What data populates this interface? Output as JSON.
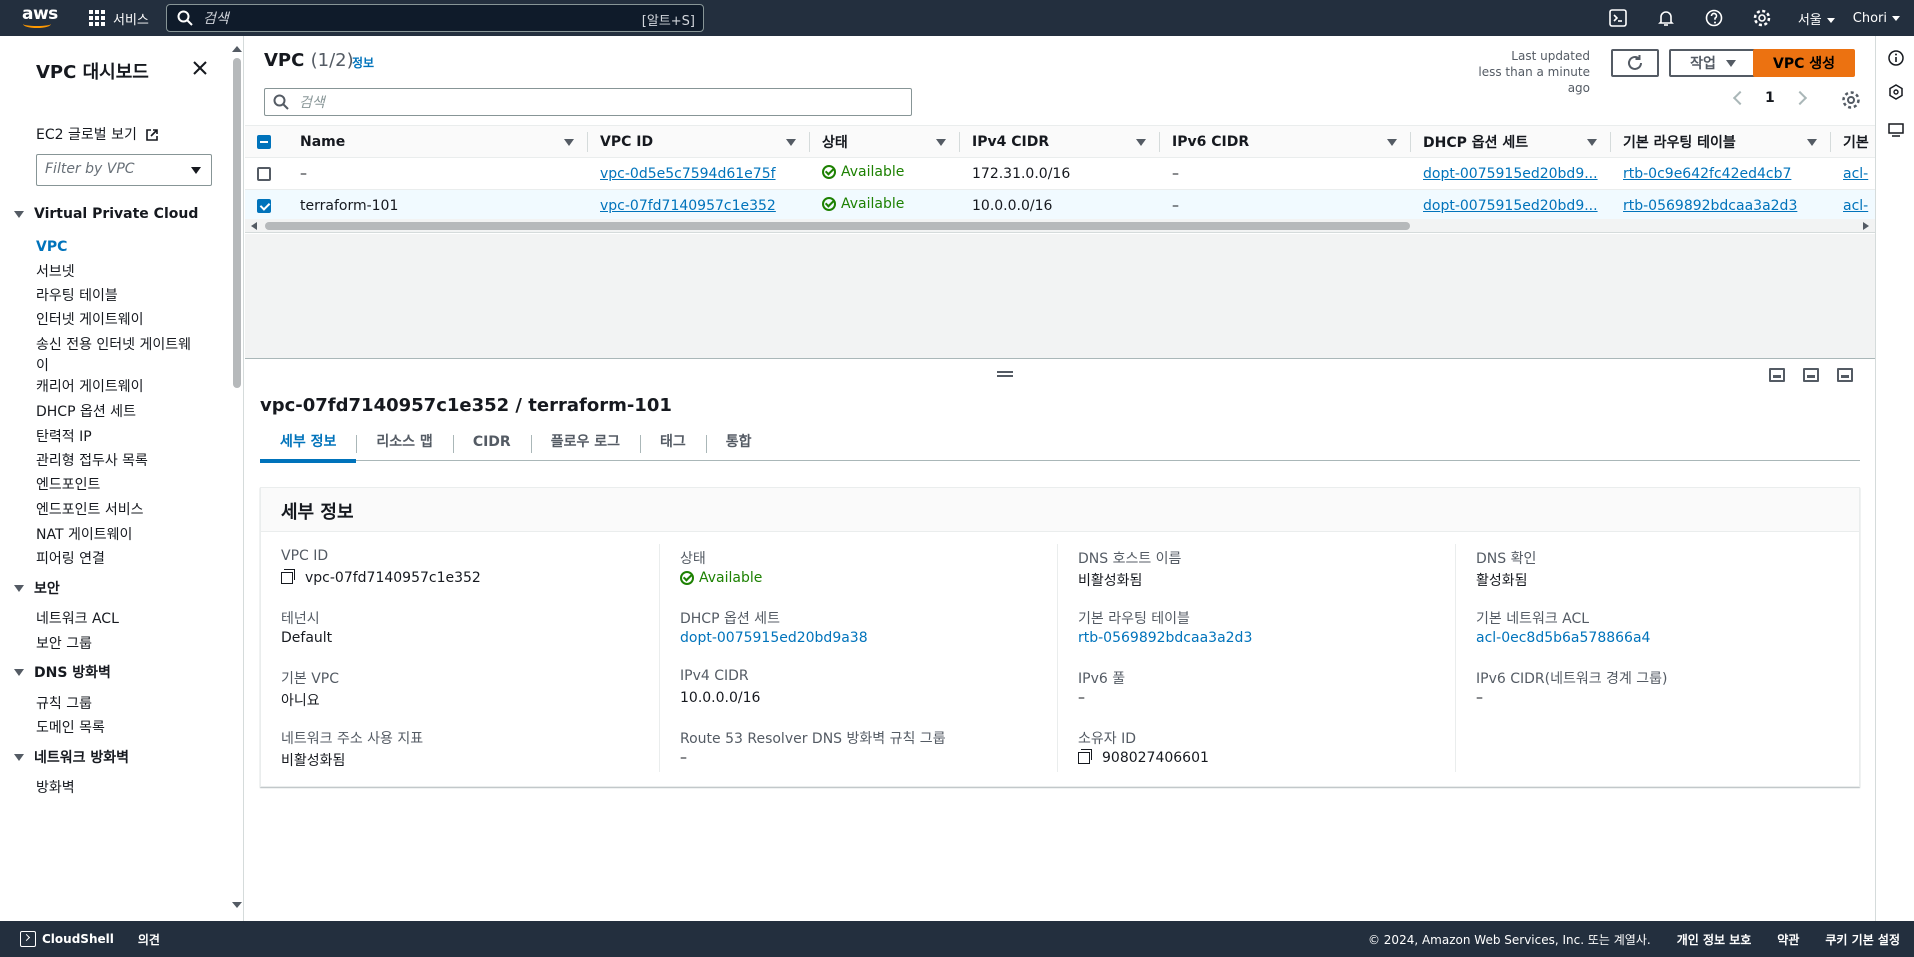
{
  "topnav": {
    "logo": "aws",
    "services": "서비스",
    "search_placeholder": "검색",
    "search_shortcut": "[알트+S]",
    "region": "서울",
    "user": "Chori",
    "icons": [
      "cloudshell-icon",
      "bell-icon",
      "help-icon",
      "gear-icon"
    ]
  },
  "sidebar": {
    "title": "VPC 대시보드",
    "ec2_global": "EC2 글로벌 보기",
    "filter_placeholder": "Filter by VPC",
    "sections": [
      {
        "title": "Virtual Private Cloud",
        "items": [
          "VPC",
          "서브넷",
          "라우팅 테이블",
          "인터넷 게이트웨이",
          "송신 전용 인터넷 게이트웨이",
          "캐리어 게이트웨이",
          "DHCP 옵션 세트",
          "탄력적 IP",
          "관리형 접두사 목록",
          "엔드포인트",
          "엔드포인트 서비스",
          "NAT 게이트웨이",
          "피어링 연결"
        ]
      },
      {
        "title": "보안",
        "items": [
          "네트워크 ACL",
          "보안 그룹"
        ]
      },
      {
        "title": "DNS 방화벽",
        "items": [
          "규칙 그룹",
          "도메인 목록"
        ]
      },
      {
        "title": "네트워크 방화벽",
        "items": [
          "방화벽"
        ]
      }
    ],
    "active_item": "VPC"
  },
  "table": {
    "title": "VPC",
    "count": "(1/2)",
    "info": "정보",
    "updated_line1": "Last updated",
    "updated_line2": "less than a minute ago",
    "action_label": "작업",
    "create_label": "VPC 생성",
    "search_placeholder": "검색",
    "page": "1",
    "columns": [
      "Name",
      "VPC ID",
      "상태",
      "IPv4 CIDR",
      "IPv6 CIDR",
      "DHCP 옵션 세트",
      "기본 라우팅 테이블",
      "기본"
    ],
    "rows": [
      {
        "name": "–",
        "vpc_id": "vpc-0d5e5c7594d61e75f",
        "state": "Available",
        "ipv4": "172.31.0.0/16",
        "ipv6": "–",
        "dhcp": "dopt-0075915ed20bd9...",
        "rtb": "rtb-0c9e642fc42ed4cb7",
        "acl": "acl-",
        "selected": false
      },
      {
        "name": "terraform-101",
        "vpc_id": "vpc-07fd7140957c1e352",
        "state": "Available",
        "ipv4": "10.0.0.0/16",
        "ipv6": "–",
        "dhcp": "dopt-0075915ed20bd9...",
        "rtb": "rtb-0569892bdcaa3a2d3",
        "acl": "acl-",
        "selected": true
      }
    ]
  },
  "details": {
    "title": "vpc-07fd7140957c1e352 / terraform-101",
    "tabs": [
      "세부 정보",
      "리소스 맵",
      "CIDR",
      "플로우 로그",
      "태그",
      "통합"
    ],
    "section_title": "세부 정보",
    "columns": [
      [
        {
          "label": "VPC ID",
          "value": "vpc-07fd7140957c1e352",
          "copy": true
        },
        {
          "label": "테넌시",
          "value": "Default"
        },
        {
          "label": "기본 VPC",
          "value": "아니요"
        },
        {
          "label": "네트워크 주소 사용 지표",
          "value": "비활성화됨"
        }
      ],
      [
        {
          "label": "상태",
          "value": "Available",
          "status": true
        },
        {
          "label": "DHCP 옵션 세트",
          "value": "dopt-0075915ed20bd9a38",
          "link": true
        },
        {
          "label": "IPv4 CIDR",
          "value": "10.0.0.0/16"
        },
        {
          "label": "Route 53 Resolver DNS 방화벽 규칙 그룹",
          "value": "–"
        }
      ],
      [
        {
          "label": "DNS 호스트 이름",
          "value": "비활성화됨"
        },
        {
          "label": "기본 라우팅 테이블",
          "value": "rtb-0569892bdcaa3a2d3",
          "link": true
        },
        {
          "label": "IPv6 풀",
          "value": "–"
        },
        {
          "label": "소유자 ID",
          "value": "908027406601",
          "copy": true
        }
      ],
      [
        {
          "label": "DNS 확인",
          "value": "활성화됨"
        },
        {
          "label": "기본 네트워크 ACL",
          "value": "acl-0ec8d5b6a578866a4",
          "link": true
        },
        {
          "label": "IPv6 CIDR(네트워크 경계 그룹)",
          "value": "–"
        }
      ]
    ]
  },
  "footer": {
    "cloudshell": "CloudShell",
    "feedback": "의견",
    "copyright": "© 2024, Amazon Web Services, Inc. 또는 계열사.",
    "privacy": "개인 정보 보호",
    "terms": "약관",
    "cookies": "쿠키 기본 설정"
  },
  "colors": {
    "nav": "#232f3e",
    "accent": "#ec7211",
    "link": "#0073bb",
    "success": "#1d8102"
  }
}
